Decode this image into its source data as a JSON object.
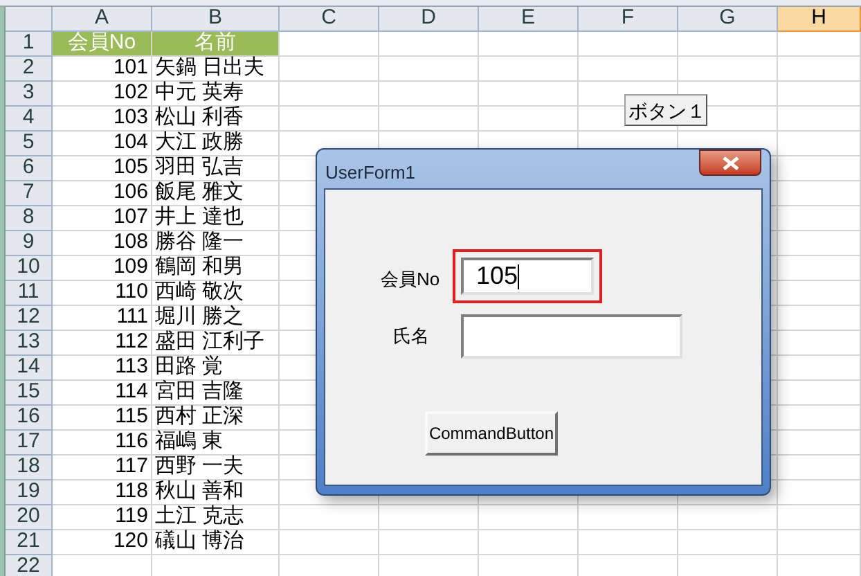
{
  "sheet": {
    "columns": [
      {
        "label": "A",
        "selected": false
      },
      {
        "label": "B",
        "selected": false
      },
      {
        "label": "C",
        "selected": false
      },
      {
        "label": "D",
        "selected": false
      },
      {
        "label": "E",
        "selected": false
      },
      {
        "label": "F",
        "selected": false
      },
      {
        "label": "G",
        "selected": false
      },
      {
        "label": "H",
        "selected": true
      }
    ],
    "rows": [
      {
        "number": "1",
        "kind": "header",
        "cells": [
          "会員No",
          "名前"
        ]
      },
      {
        "number": "2",
        "kind": "data",
        "cells": [
          "101",
          "矢鍋 日出夫"
        ]
      },
      {
        "number": "3",
        "kind": "data",
        "cells": [
          "102",
          "中元 英寿"
        ]
      },
      {
        "number": "4",
        "kind": "data",
        "cells": [
          "103",
          "松山 利香"
        ]
      },
      {
        "number": "5",
        "kind": "data",
        "cells": [
          "104",
          "大江 政勝"
        ]
      },
      {
        "number": "6",
        "kind": "data",
        "cells": [
          "105",
          "羽田 弘吉"
        ]
      },
      {
        "number": "7",
        "kind": "data",
        "cells": [
          "106",
          "飯尾 雅文"
        ]
      },
      {
        "number": "8",
        "kind": "data",
        "cells": [
          "107",
          "井上 達也"
        ]
      },
      {
        "number": "9",
        "kind": "data",
        "cells": [
          "108",
          "勝谷 隆一"
        ]
      },
      {
        "number": "10",
        "kind": "data",
        "cells": [
          "109",
          "鶴岡 和男"
        ]
      },
      {
        "number": "11",
        "kind": "data",
        "cells": [
          "110",
          "西崎 敬次"
        ]
      },
      {
        "number": "12",
        "kind": "data",
        "cells": [
          "111",
          "堀川 勝之"
        ]
      },
      {
        "number": "13",
        "kind": "data",
        "cells": [
          "112",
          "盛田 江利子"
        ]
      },
      {
        "number": "14",
        "kind": "data",
        "cells": [
          "113",
          "田路 覚"
        ]
      },
      {
        "number": "15",
        "kind": "data",
        "cells": [
          "114",
          "宮田 吉隆"
        ]
      },
      {
        "number": "16",
        "kind": "data",
        "cells": [
          "115",
          "西村 正深"
        ]
      },
      {
        "number": "17",
        "kind": "data",
        "cells": [
          "116",
          "福嶋 東"
        ]
      },
      {
        "number": "18",
        "kind": "data",
        "cells": [
          "117",
          "西野 一夫"
        ]
      },
      {
        "number": "19",
        "kind": "data",
        "cells": [
          "118",
          "秋山 善和"
        ]
      },
      {
        "number": "20",
        "kind": "data",
        "cells": [
          "119",
          "土江 克志"
        ]
      },
      {
        "number": "21",
        "kind": "data",
        "cells": [
          "120",
          "礒山 博治"
        ]
      },
      {
        "number": "22",
        "kind": "data",
        "cells": []
      }
    ],
    "button": "ボタン１"
  },
  "dialog": {
    "title": "UserForm1",
    "fields": [
      {
        "label": "会員No",
        "value": "105",
        "focused": true
      },
      {
        "label": "氏名",
        "focused": false
      }
    ],
    "button": "CommandButton"
  }
}
